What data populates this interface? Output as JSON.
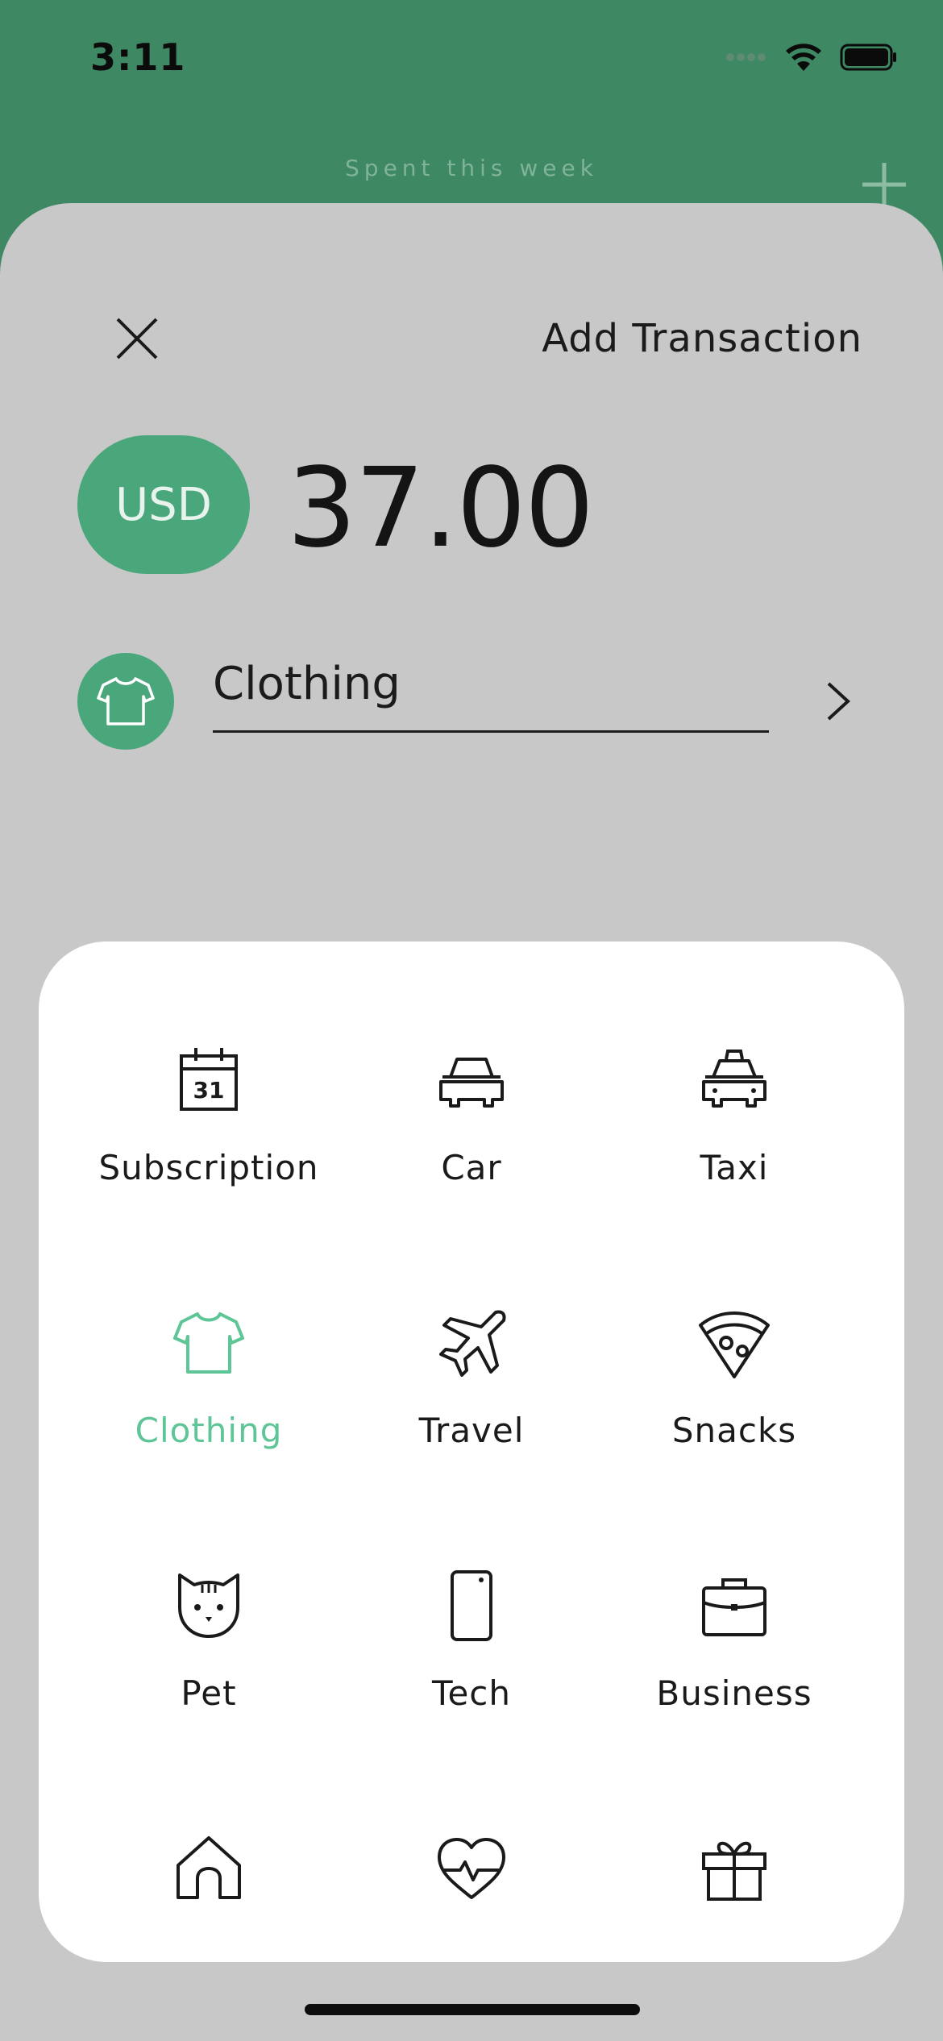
{
  "status_bar": {
    "time": "3:11"
  },
  "background": {
    "header_text": "Spent this week"
  },
  "sheet": {
    "title": "Add Transaction",
    "currency": "USD",
    "amount": "37.00",
    "category_value": "Clothing"
  },
  "category_picker": {
    "items": [
      {
        "label": "Subscription",
        "icon": "calendar-icon",
        "selected": false
      },
      {
        "label": "Car",
        "icon": "car-icon",
        "selected": false
      },
      {
        "label": "Taxi",
        "icon": "taxi-icon",
        "selected": false
      },
      {
        "label": "Clothing",
        "icon": "shirt-icon",
        "selected": true
      },
      {
        "label": "Travel",
        "icon": "airplane-icon",
        "selected": false
      },
      {
        "label": "Snacks",
        "icon": "pizza-icon",
        "selected": false
      },
      {
        "label": "Pet",
        "icon": "cat-icon",
        "selected": false
      },
      {
        "label": "Tech",
        "icon": "phone-icon",
        "selected": false
      },
      {
        "label": "Business",
        "icon": "briefcase-icon",
        "selected": false
      },
      {
        "label": "",
        "icon": "home-icon",
        "selected": false
      },
      {
        "label": "",
        "icon": "heart-pulse-icon",
        "selected": false
      },
      {
        "label": "",
        "icon": "gift-icon",
        "selected": false
      }
    ]
  },
  "colors": {
    "accent": "#49a77b",
    "selected": "#5ec596",
    "header_bg": "#3e8863",
    "sheet_bg": "#c8c8c8"
  }
}
